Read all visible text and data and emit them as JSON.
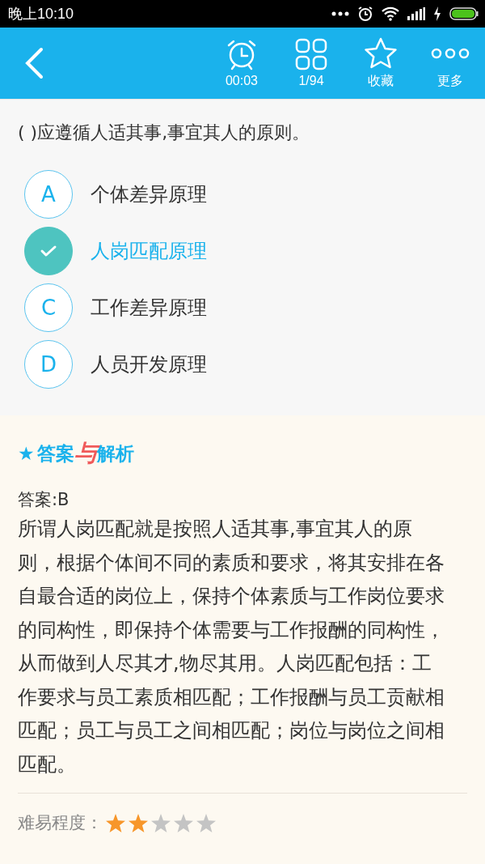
{
  "status_bar": {
    "time": "晚上10:10"
  },
  "toolbar": {
    "items": [
      {
        "kind": "timer",
        "label": "00:03"
      },
      {
        "kind": "grid",
        "label": "1/94"
      },
      {
        "kind": "star",
        "label": "收藏"
      },
      {
        "kind": "more",
        "label": "更多"
      }
    ]
  },
  "question": {
    "text": "(    )应遵循人适其事,事宜其人的原则。",
    "options": [
      {
        "letter": "A",
        "text": "个体差异原理",
        "selected": false
      },
      {
        "text": "人岗匹配原理",
        "selected": true
      },
      {
        "letter": "C",
        "text": "工作差异原理",
        "selected": false
      },
      {
        "letter": "D",
        "text": "人员开发原理",
        "selected": false
      }
    ]
  },
  "analysis": {
    "heading": {
      "icon": "★",
      "before": "答案",
      "joiner": "与",
      "after": "解析"
    },
    "answer": "答案:B",
    "explanation": "所谓人岗匹配就是按照人适其事,事宜其人的原则，根据个体间不同的素质和要求，将其安排在各自最合适的岗位上，保持个体素质与工作岗位要求的同构性，即保持个体需要与工作报酬的同构性，从而做到人尽其才,物尽其用。人岗匹配包括：工作要求与员工素质相匹配；工作报酬与员工贡献相匹配；员工与员工之间相匹配；岗位与岗位之间相匹配。",
    "difficulty": {
      "label": "难易程度：",
      "stars": 2
    }
  }
}
